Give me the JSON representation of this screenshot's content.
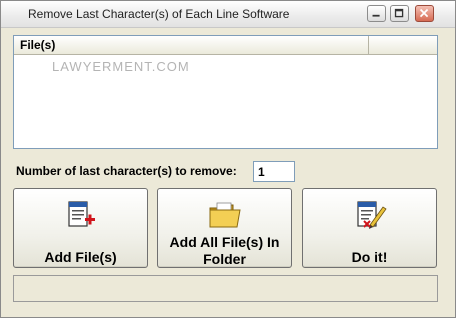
{
  "window": {
    "title": "Remove Last Character(s) of Each Line Software",
    "controls": {
      "minimize": "minimize",
      "maximize": "maximize",
      "close": "close"
    }
  },
  "file_list": {
    "columns": [
      "File(s)",
      ""
    ],
    "watermark": "LAWYERMENT.COM",
    "rows": []
  },
  "options": {
    "num_chars_label": "Number of last character(s) to remove:",
    "num_chars_value": "1"
  },
  "buttons": {
    "add_files": "Add File(s)",
    "add_folder_line1": "Add All File(s) In",
    "add_folder_line2": "Folder",
    "do_it": "Do it!"
  },
  "icons": {
    "add_files": "document-add-icon",
    "add_folder": "folder-icon",
    "do_it": "document-edit-icon"
  },
  "status": {
    "text": ""
  }
}
